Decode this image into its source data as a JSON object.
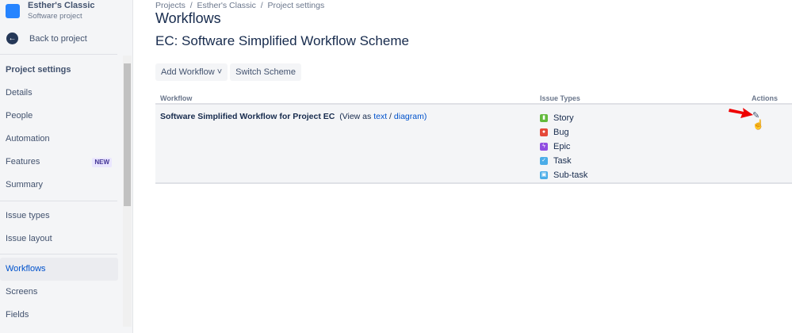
{
  "sidebar": {
    "project_name": "Esther's Classic",
    "project_type": "Software project",
    "back": "Back to project",
    "items": [
      {
        "label": "Project settings"
      },
      {
        "label": "Details"
      },
      {
        "label": "People"
      },
      {
        "label": "Automation"
      },
      {
        "label": "Features",
        "badge": "NEW"
      },
      {
        "label": "Summary"
      },
      {
        "label": "Issue types"
      },
      {
        "label": "Issue layout"
      },
      {
        "label": "Workflows"
      },
      {
        "label": "Screens"
      },
      {
        "label": "Fields"
      }
    ]
  },
  "breadcrumb": {
    "text": "Projects  /  Esther's Classic  /  Project settings"
  },
  "page": {
    "title": "Workflows",
    "scheme": "EC: Software Simplified Workflow Scheme",
    "add_workflow": "Add Workflow",
    "switch_scheme": "Switch Scheme"
  },
  "table": {
    "headers": {
      "workflow": "Workflow",
      "issue_types": "Issue Types",
      "actions": "Actions"
    },
    "row": {
      "name": "Software Simplified Workflow for Project EC",
      "view_as": "(View as",
      "text_link": "text",
      "slash": "/",
      "diagram_link": "diagram)",
      "issue_types": [
        {
          "label": "Story",
          "color": "#63ba3c"
        },
        {
          "label": "Bug",
          "color": "#e5493a"
        },
        {
          "label": "Epic",
          "color": "#904ee2"
        },
        {
          "label": "Task",
          "color": "#4bade8"
        },
        {
          "label": "Sub-task",
          "color": "#4bade8"
        }
      ]
    }
  }
}
